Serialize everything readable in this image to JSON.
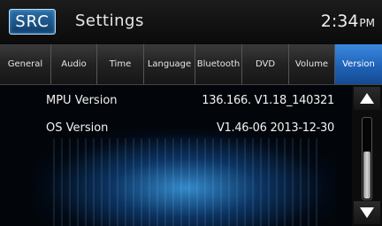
{
  "header": {
    "source_button_label": "SRC",
    "title": "Settings",
    "clock_time": "2:34",
    "clock_ampm": "PM"
  },
  "tabs": [
    {
      "label": "General",
      "active": false
    },
    {
      "label": "Audio",
      "active": false
    },
    {
      "label": "Time",
      "active": false
    },
    {
      "label": "Language",
      "active": false
    },
    {
      "label": "Bluetooth",
      "active": false
    },
    {
      "label": "DVD",
      "active": false
    },
    {
      "label": "Volume",
      "active": false
    },
    {
      "label": "Version",
      "active": true
    }
  ],
  "version_list": [
    {
      "label": "MPU Version",
      "value": "136.166. V1.18_140321"
    },
    {
      "label": "OS Version",
      "value": "V1.46-06 2013-12-30"
    }
  ],
  "scrollbar": {
    "up_icon": "triangle-up-icon",
    "down_icon": "triangle-down-icon",
    "thumb_fraction": 0.6
  },
  "colors": {
    "accent": "#2f7fd6",
    "tab_active": "#2a74cc",
    "glow": "#3ca0eb"
  }
}
